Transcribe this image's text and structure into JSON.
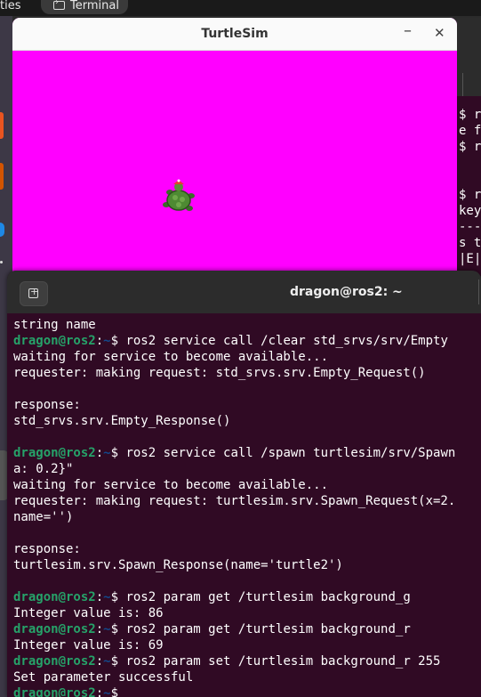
{
  "topbar": {
    "activities_label": "ties",
    "app_label": "Terminal"
  },
  "background_terminal": {
    "visible_lines": [
      "$ r",
      "e fo",
      "$ r",
      "",
      "",
      "$ r",
      "key",
      "---",
      "s t",
      "|E|"
    ]
  },
  "turtlesim": {
    "title": "TurtleSim",
    "background_color": "#ff00ff",
    "minimize_glyph": "–",
    "close_glyph": "✕"
  },
  "terminal": {
    "title": "dragon@ros2: ~",
    "lines": [
      {
        "t": "string name"
      },
      {
        "user": "dragon@ros2",
        "colon": ":",
        "path": "~",
        "cmd": "$ ros2 service call /clear std_srvs/srv/Empty"
      },
      {
        "t": "waiting for service to become available..."
      },
      {
        "t": "requester: making request: std_srvs.srv.Empty_Request()"
      },
      {
        "t": ""
      },
      {
        "t": "response:"
      },
      {
        "t": "std_srvs.srv.Empty_Response()"
      },
      {
        "t": ""
      },
      {
        "user": "dragon@ros2",
        "colon": ":",
        "path": "~",
        "cmd": "$ ros2 service call /spawn turtlesim/srv/Spawn"
      },
      {
        "t": "a: 0.2}\""
      },
      {
        "t": "waiting for service to become available..."
      },
      {
        "t": "requester: making request: turtlesim.srv.Spawn_Request(x=2."
      },
      {
        "t": "name='')"
      },
      {
        "t": ""
      },
      {
        "t": "response:"
      },
      {
        "t": "turtlesim.srv.Spawn_Response(name='turtle2')"
      },
      {
        "t": ""
      },
      {
        "user": "dragon@ros2",
        "colon": ":",
        "path": "~",
        "cmd": "$ ros2 param get /turtlesim background_g"
      },
      {
        "t": "Integer value is: 86"
      },
      {
        "user": "dragon@ros2",
        "colon": ":",
        "path": "~",
        "cmd": "$ ros2 param get /turtlesim background_r"
      },
      {
        "t": "Integer value is: 69"
      },
      {
        "user": "dragon@ros2",
        "colon": ":",
        "path": "~",
        "cmd": "$ ros2 param set /turtlesim background_r 255"
      },
      {
        "t": "Set parameter successful"
      },
      {
        "user": "dragon@ros2",
        "colon": ":",
        "path": "~",
        "cmd": "$ "
      }
    ]
  }
}
